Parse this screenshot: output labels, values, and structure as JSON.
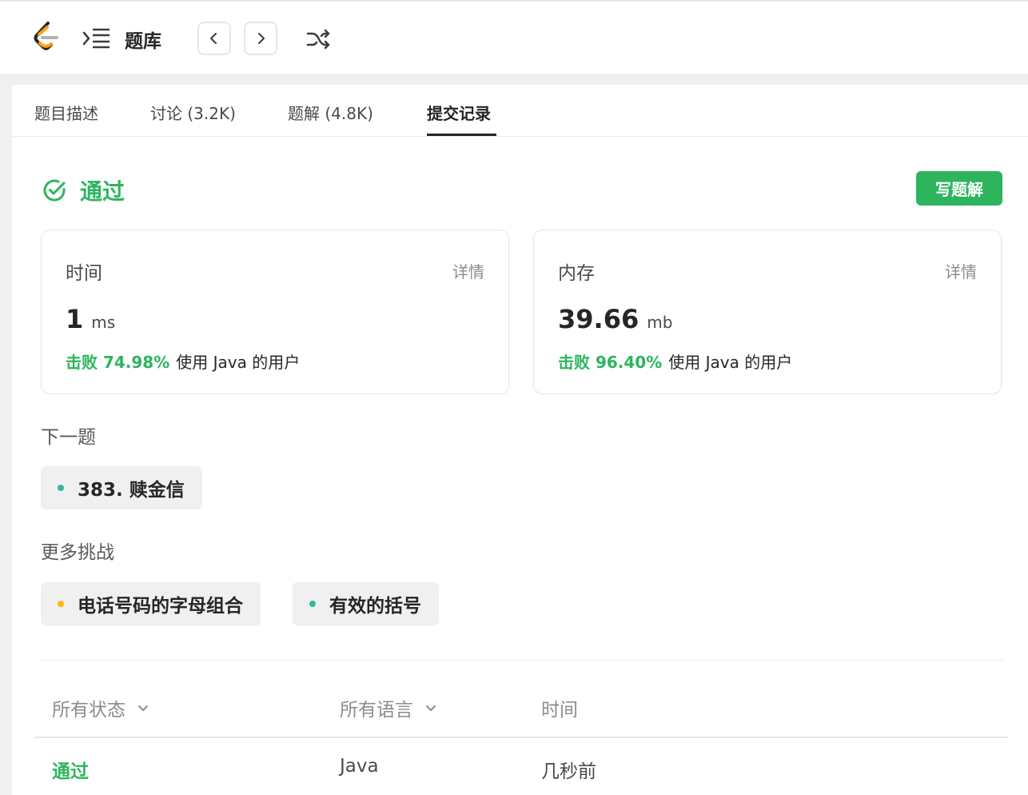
{
  "topbar": {
    "logo_icon": "leetcode-logo-icon",
    "list_icon": "list-indent-icon",
    "bank_label": "题库",
    "prev_icon": "chevron-left-icon",
    "next_icon": "chevron-right-icon",
    "shuffle_icon": "shuffle-icon"
  },
  "tabs": [
    {
      "label": "题目描述"
    },
    {
      "label": "讨论 (3.2K)"
    },
    {
      "label": "题解 (4.8K)"
    },
    {
      "label": "提交记录",
      "active": true
    }
  ],
  "result": {
    "status": "通过",
    "status_icon": "check-circle-icon",
    "write_solution": "写题解"
  },
  "stats": [
    {
      "title": "时间",
      "detail": "详情",
      "value": "1",
      "unit": "ms",
      "beat": "击败 74.98%",
      "beat_suffix": "使用 Java 的用户"
    },
    {
      "title": "内存",
      "detail": "详情",
      "value": "39.66",
      "unit": "mb",
      "beat": "击败 96.40%",
      "beat_suffix": "使用 Java 的用户"
    }
  ],
  "next_problem": {
    "label": "下一题",
    "item": {
      "text": "383. 赎金信",
      "difficulty_color": "#2cbb9c"
    }
  },
  "more_challenges": {
    "label": "更多挑战",
    "items": [
      {
        "text": "电话号码的字母组合",
        "difficulty_color": "#ffb800"
      },
      {
        "text": "有效的括号",
        "difficulty_color": "#2cbb9c"
      }
    ]
  },
  "submissions": {
    "headers": {
      "status": "所有状态",
      "language": "所有语言",
      "time": "时间"
    },
    "rows": [
      {
        "status": "通过",
        "language": "Java",
        "time": "几秒前"
      }
    ]
  },
  "colors": {
    "accent_green": "#2db55d"
  }
}
